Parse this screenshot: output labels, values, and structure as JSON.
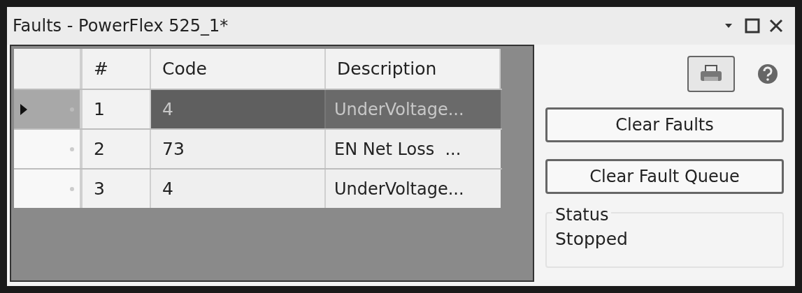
{
  "window": {
    "title": "Faults - PowerFlex 525_1*"
  },
  "table": {
    "columns": [
      "#",
      "Code",
      "Description"
    ],
    "rows": [
      {
        "number": "1",
        "code": "4",
        "description": "UnderVoltage...",
        "selected": true
      },
      {
        "number": "2",
        "code": "73",
        "description": "EN Net Loss  ...",
        "selected": false
      },
      {
        "number": "3",
        "code": "4",
        "description": "UnderVoltage...",
        "selected": false
      }
    ]
  },
  "buttons": [
    "Clear Faults",
    "Clear Fault Queue"
  ],
  "status": {
    "label": "Status",
    "value": "Stopped"
  }
}
